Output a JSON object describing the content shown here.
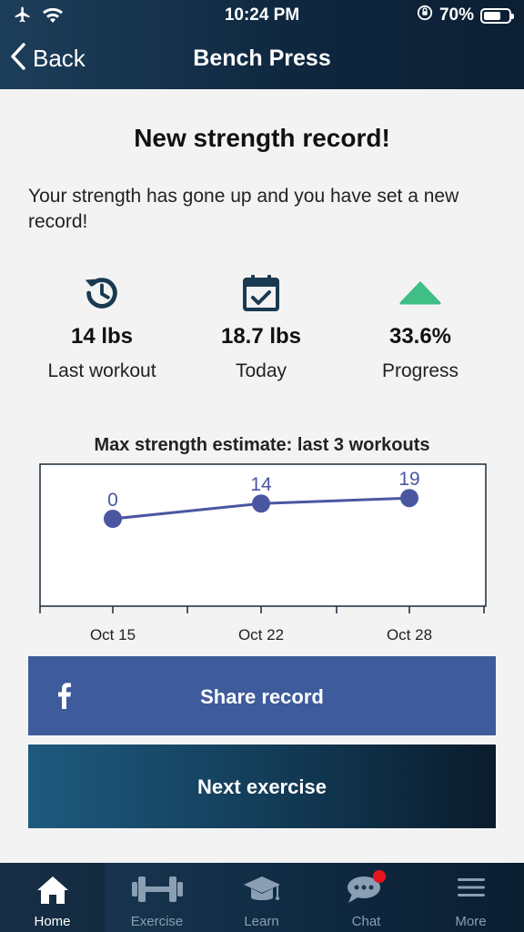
{
  "status_bar": {
    "time": "10:24 PM",
    "battery": "70%",
    "battery_level": 0.7
  },
  "nav": {
    "back_label": "Back",
    "title": "Bench Press"
  },
  "record": {
    "title": "New strength record!",
    "description": "Your strength has gone up and you have set a new record!"
  },
  "stats": [
    {
      "icon": "history-icon",
      "value": "14 lbs",
      "label": "Last workout"
    },
    {
      "icon": "calendar-check-icon",
      "value": "18.7 lbs",
      "label": "Today"
    },
    {
      "icon": "up-triangle-icon",
      "value": "33.6%",
      "label": "Progress"
    }
  ],
  "chart_data": {
    "type": "line",
    "title": "Max strength estimate: last 3 workouts",
    "categories": [
      "Oct 15",
      "Oct 22",
      "Oct 28"
    ],
    "values": [
      0,
      14,
      19
    ],
    "data_labels": [
      "0",
      "14",
      "19"
    ],
    "ylim": [
      -80,
      50
    ],
    "color": "#4a57a0"
  },
  "share": {
    "label": "Share record",
    "icon": "facebook-icon"
  },
  "next": {
    "label": "Next exercise"
  },
  "tabs": [
    {
      "label": "Home",
      "icon": "home-icon",
      "active": true
    },
    {
      "label": "Exercise",
      "icon": "dumbbell-icon",
      "active": false
    },
    {
      "label": "Learn",
      "icon": "graduation-cap-icon",
      "active": false
    },
    {
      "label": "Chat",
      "icon": "chat-icon",
      "active": false
    },
    {
      "label": "More",
      "icon": "menu-icon",
      "active": false
    }
  ],
  "colors": {
    "accent": "#1a3a52",
    "facebook": "#3e5b9c",
    "progress_green": "#3fbf85",
    "badge": "#e8141e"
  }
}
